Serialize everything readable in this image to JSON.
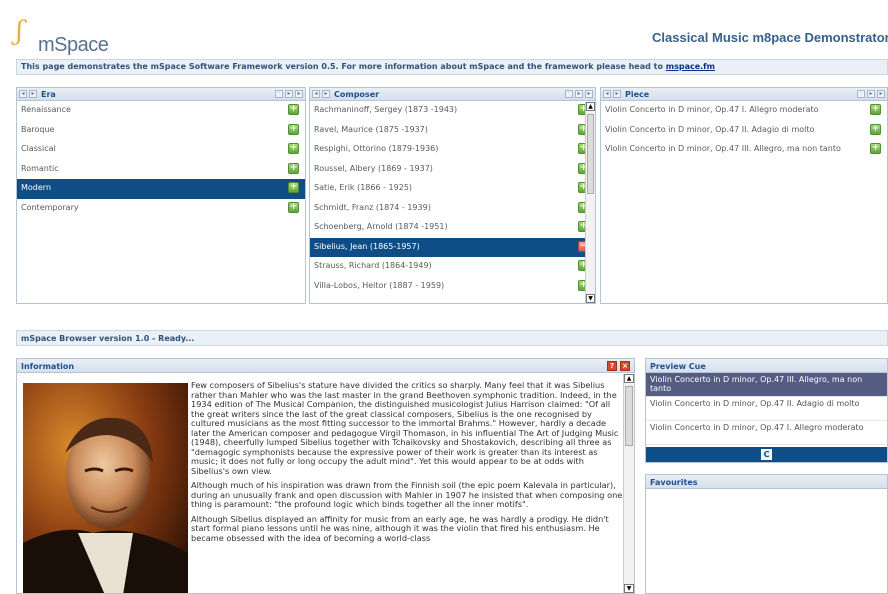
{
  "header": {
    "logo_text": "mSpace",
    "app_title": "Classical Music m8pace Demonstrator",
    "info_text": "This page demonstrates the mSpace Software Framework version 0.5. For more information about mSpace and the framework please head to ",
    "info_link": "mspace.fm"
  },
  "columns": [
    {
      "title": "Era",
      "items": [
        "Renaissance",
        "Baroque",
        "Classical",
        "Romantic",
        "Modern",
        "Contemporary"
      ],
      "selected": "Modern"
    },
    {
      "title": "Composer",
      "items": [
        "Rachmaninoff, Sergey (1873 -1943)",
        "Ravel, Maurice (1875 -1937)",
        "Respighi, Ottorino (1879-1936)",
        "Roussel, Albery (1869 - 1937)",
        "Satie, Erik (1866 - 1925)",
        "Schmidt, Franz (1874 - 1939)",
        "Schoenberg, Arnold (1874 -1951)",
        "Sibelius, Jean (1865-1957)",
        "Strauss, Richard (1864-1949)",
        "Villa-Lobos, Heitor (1887 - 1959)"
      ],
      "selected": "Sibelius, Jean (1865-1957)"
    },
    {
      "title": "Piece",
      "items": [
        "Violin Concerto in D minor, Op.47 I. Allegro moderato",
        "Violin Concerto in D minor, Op.47 II. Adagio di molto",
        "Violin Concerto in D minor, Op.47 III. Allegro, ma non tanto"
      ],
      "selected": ""
    }
  ],
  "status": "mSpace Browser version 1.0 - Ready...",
  "information": {
    "title": "Information",
    "paragraphs": [
      "Few composers of Sibelius's stature have divided the critics so sharply. Many feel that it was Sibelius rather than Mahler who was the last master in the grand Beethoven symphonic tradition. Indeed, in the 1934 edition of The Musical Companion, the distinguished musicologist Julius Harrison claimed: \"Of all the great writers since the last of the great classical composers, Sibelius is the one recognised by cultured musicians as the most fitting successor to the immortal Brahms.\" However, hardly a decade later the American composer and pedagogue Virgil Thomason, in his influential The Art of Judging Music (1948), cheerfully lumped Sibelius together with Tchaikovsky and Shostakovich, describing all three as \"demagogic symphonists because the expressive power of their work is greater than its interest as music; it does not fully or long occupy the adult mind\". Yet this would appear to be at odds with Sibelius's own view.",
      "Although much of his inspiration was drawn from the Finnish soil (the epic poem Kalevala in particular), during an unusually frank and open discussion with Mahler in 1907 he insisted that when composing one thing is paramount: \"the profound logic which binds together all the inner motifs\".",
      "Although Sibelius displayed an affinity for music from an early age, he was hardly a prodigy. He didn't start formal piano lessons until he was nine, although it was the violin that fired his enthusiasm. He became obsessed with the idea of becoming a world-class"
    ]
  },
  "preview_cue": {
    "title": "Preview Cue",
    "items": [
      "Violin Concerto in D minor, Op.47 III. Allegro, ma non tanto",
      "Violin Concerto in D minor, Op.47 II. Adagio di molto",
      "Violin Concerto in D minor, Op.47 I. Allegro moderato"
    ],
    "selected": "Violin Concerto in D minor, Op.47 III. Allegro, ma non tanto"
  },
  "favourites": {
    "title": "Favourites"
  },
  "icons": {
    "add": "plus-icon",
    "remove": "minus-icon",
    "play": "play-icon",
    "close": "close-icon",
    "help": "help-icon"
  },
  "colors": {
    "selection": "#0e4d86",
    "accent": "#1f4f8c",
    "cue_selected": "#555c84"
  }
}
